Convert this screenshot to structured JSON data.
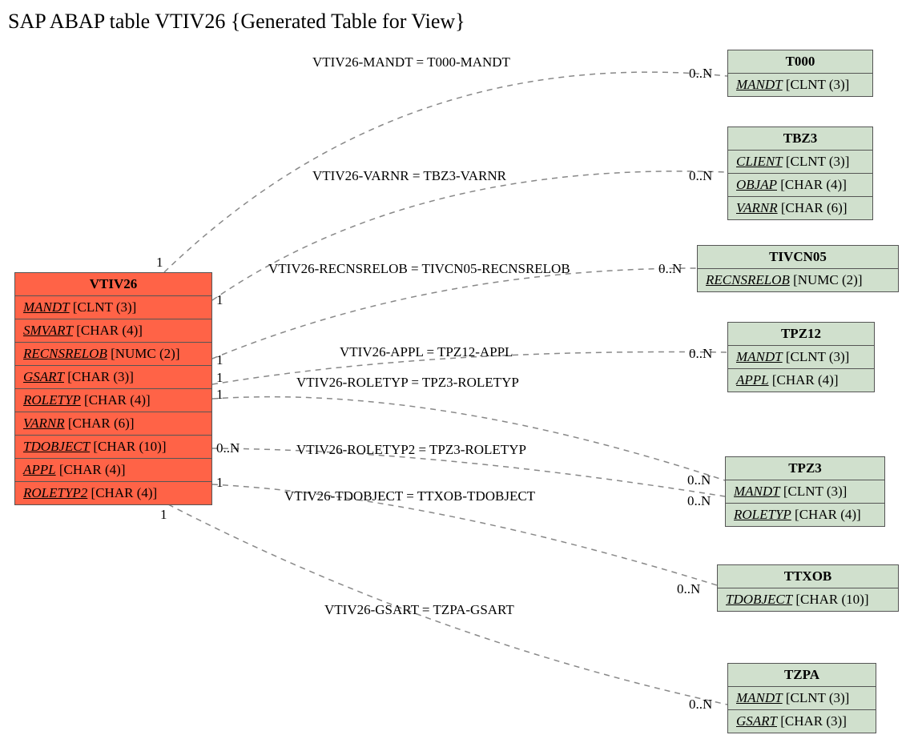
{
  "title": "SAP ABAP table VTIV26 {Generated Table for View}",
  "mainEntity": {
    "name": "VTIV26",
    "fields": [
      {
        "name": "MANDT",
        "type": "[CLNT (3)]"
      },
      {
        "name": "SMVART",
        "type": "[CHAR (4)]"
      },
      {
        "name": "RECNSRELOB",
        "type": "[NUMC (2)]"
      },
      {
        "name": "GSART",
        "type": "[CHAR (3)]"
      },
      {
        "name": "ROLETYP",
        "type": "[CHAR (4)]"
      },
      {
        "name": "VARNR",
        "type": "[CHAR (6)]"
      },
      {
        "name": "TDOBJECT",
        "type": "[CHAR (10)]"
      },
      {
        "name": "APPL",
        "type": "[CHAR (4)]"
      },
      {
        "name": "ROLETYP2",
        "type": "[CHAR (4)]"
      }
    ]
  },
  "relEntities": [
    {
      "name": "T000",
      "fields": [
        {
          "name": "MANDT",
          "type": "[CLNT (3)]"
        }
      ]
    },
    {
      "name": "TBZ3",
      "fields": [
        {
          "name": "CLIENT",
          "type": "[CLNT (3)]"
        },
        {
          "name": "OBJAP",
          "type": "[CHAR (4)]"
        },
        {
          "name": "VARNR",
          "type": "[CHAR (6)]"
        }
      ]
    },
    {
      "name": "TIVCN05",
      "fields": [
        {
          "name": "RECNSRELOB",
          "type": "[NUMC (2)]"
        }
      ]
    },
    {
      "name": "TPZ12",
      "fields": [
        {
          "name": "MANDT",
          "type": "[CLNT (3)]"
        },
        {
          "name": "APPL",
          "type": "[CHAR (4)]"
        }
      ]
    },
    {
      "name": "TPZ3",
      "fields": [
        {
          "name": "MANDT",
          "type": "[CLNT (3)]"
        },
        {
          "name": "ROLETYP",
          "type": "[CHAR (4)]"
        }
      ]
    },
    {
      "name": "TTXOB",
      "fields": [
        {
          "name": "TDOBJECT",
          "type": "[CHAR (10)]"
        }
      ]
    },
    {
      "name": "TZPA",
      "fields": [
        {
          "name": "MANDT",
          "type": "[CLNT (3)]"
        },
        {
          "name": "GSART",
          "type": "[CHAR (3)]"
        }
      ]
    }
  ],
  "edges": [
    {
      "label": "VTIV26-MANDT = T000-MANDT",
      "leftCard": "1",
      "rightCard": "0..N"
    },
    {
      "label": "VTIV26-VARNR = TBZ3-VARNR",
      "leftCard": "1",
      "rightCard": "0..N"
    },
    {
      "label": "VTIV26-RECNSRELOB = TIVCN05-RECNSRELOB",
      "leftCard": "1",
      "rightCard": "0..N"
    },
    {
      "label": "VTIV26-APPL = TPZ12-APPL",
      "leftCard": "1",
      "rightCard": "0..N"
    },
    {
      "label": "VTIV26-ROLETYP = TPZ3-ROLETYP",
      "leftCard": "1",
      "rightCard": "0..N"
    },
    {
      "label": "VTIV26-ROLETYP2 = TPZ3-ROLETYP",
      "leftCard": "0..N",
      "rightCard": "0..N"
    },
    {
      "label": "VTIV26-TDOBJECT = TTXOB-TDOBJECT",
      "leftCard": "1",
      "rightCard": "0..N"
    },
    {
      "label": "VTIV26-GSART = TZPA-GSART",
      "leftCard": "1",
      "rightCard": "0..N"
    }
  ]
}
